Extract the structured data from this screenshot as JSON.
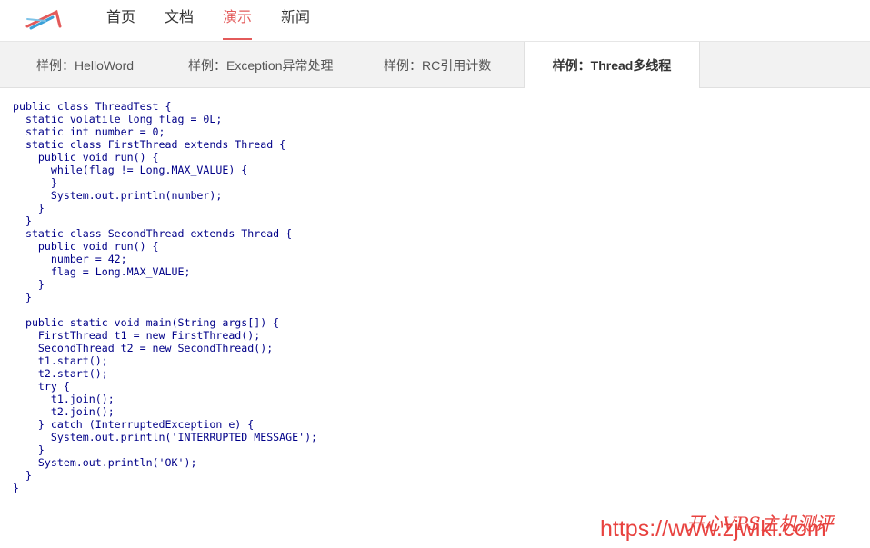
{
  "nav": {
    "items": [
      {
        "label": "首页",
        "active": false
      },
      {
        "label": "文档",
        "active": false
      },
      {
        "label": "演示",
        "active": true
      },
      {
        "label": "新闻",
        "active": false
      }
    ]
  },
  "tabs": [
    {
      "label": "样例：HelloWord",
      "active": false
    },
    {
      "label": "样例：Exception异常处理",
      "active": false
    },
    {
      "label": "样例：RC引用计数",
      "active": false
    },
    {
      "label": "样例：Thread多线程",
      "active": true
    }
  ],
  "code": {
    "lines": [
      "public class ThreadTest {",
      "  static volatile long flag = 0L;",
      "  static int number = 0;",
      "  static class FirstThread extends Thread {",
      "    public void run() {",
      "      while(flag != Long.MAX_VALUE) {",
      "      }",
      "      System.out.println(number);",
      "    }",
      "  }",
      "  static class SecondThread extends Thread {",
      "    public void run() {",
      "      number = 42;",
      "      flag = Long.MAX_VALUE;",
      "    }",
      "  }",
      "",
      "  public static void main(String args[]) {",
      "    FirstThread t1 = new FirstThread();",
      "    SecondThread t2 = new SecondThread();",
      "    t1.start();",
      "    t2.start();",
      "    try {",
      "      t1.join();",
      "      t2.join();",
      "    } catch (InterruptedException e) {",
      "      System.out.println('INTERRUPTED_MESSAGE');",
      "    }",
      "    System.out.println('OK');",
      "  }",
      "}"
    ]
  },
  "watermark": {
    "url": "https://www.zjwiki.com",
    "cn": "开心VPS主机测评"
  },
  "colors": {
    "accent": "#e35a5a",
    "code_text": "#000088",
    "watermark": "#e8423f"
  }
}
